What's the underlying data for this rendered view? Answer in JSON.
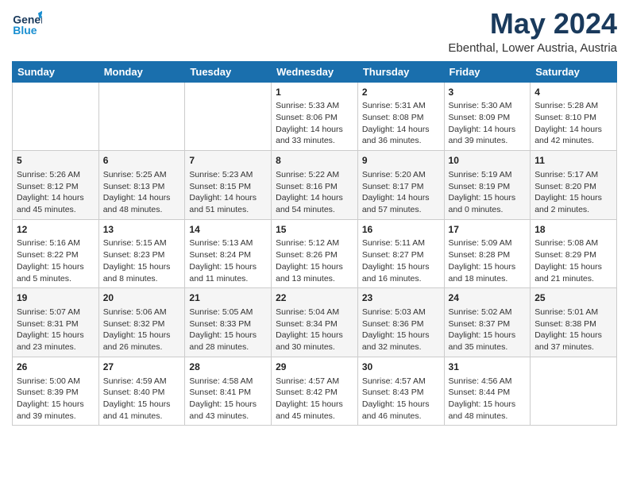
{
  "logo": {
    "line1": "General",
    "line2": "Blue"
  },
  "title": "May 2024",
  "location": "Ebenthal, Lower Austria, Austria",
  "days": [
    "Sunday",
    "Monday",
    "Tuesday",
    "Wednesday",
    "Thursday",
    "Friday",
    "Saturday"
  ],
  "weeks": [
    [
      {
        "day": "",
        "content": ""
      },
      {
        "day": "",
        "content": ""
      },
      {
        "day": "",
        "content": ""
      },
      {
        "day": "1",
        "content": "Sunrise: 5:33 AM\nSunset: 8:06 PM\nDaylight: 14 hours\nand 33 minutes."
      },
      {
        "day": "2",
        "content": "Sunrise: 5:31 AM\nSunset: 8:08 PM\nDaylight: 14 hours\nand 36 minutes."
      },
      {
        "day": "3",
        "content": "Sunrise: 5:30 AM\nSunset: 8:09 PM\nDaylight: 14 hours\nand 39 minutes."
      },
      {
        "day": "4",
        "content": "Sunrise: 5:28 AM\nSunset: 8:10 PM\nDaylight: 14 hours\nand 42 minutes."
      }
    ],
    [
      {
        "day": "5",
        "content": "Sunrise: 5:26 AM\nSunset: 8:12 PM\nDaylight: 14 hours\nand 45 minutes."
      },
      {
        "day": "6",
        "content": "Sunrise: 5:25 AM\nSunset: 8:13 PM\nDaylight: 14 hours\nand 48 minutes."
      },
      {
        "day": "7",
        "content": "Sunrise: 5:23 AM\nSunset: 8:15 PM\nDaylight: 14 hours\nand 51 minutes."
      },
      {
        "day": "8",
        "content": "Sunrise: 5:22 AM\nSunset: 8:16 PM\nDaylight: 14 hours\nand 54 minutes."
      },
      {
        "day": "9",
        "content": "Sunrise: 5:20 AM\nSunset: 8:17 PM\nDaylight: 14 hours\nand 57 minutes."
      },
      {
        "day": "10",
        "content": "Sunrise: 5:19 AM\nSunset: 8:19 PM\nDaylight: 15 hours\nand 0 minutes."
      },
      {
        "day": "11",
        "content": "Sunrise: 5:17 AM\nSunset: 8:20 PM\nDaylight: 15 hours\nand 2 minutes."
      }
    ],
    [
      {
        "day": "12",
        "content": "Sunrise: 5:16 AM\nSunset: 8:22 PM\nDaylight: 15 hours\nand 5 minutes."
      },
      {
        "day": "13",
        "content": "Sunrise: 5:15 AM\nSunset: 8:23 PM\nDaylight: 15 hours\nand 8 minutes."
      },
      {
        "day": "14",
        "content": "Sunrise: 5:13 AM\nSunset: 8:24 PM\nDaylight: 15 hours\nand 11 minutes."
      },
      {
        "day": "15",
        "content": "Sunrise: 5:12 AM\nSunset: 8:26 PM\nDaylight: 15 hours\nand 13 minutes."
      },
      {
        "day": "16",
        "content": "Sunrise: 5:11 AM\nSunset: 8:27 PM\nDaylight: 15 hours\nand 16 minutes."
      },
      {
        "day": "17",
        "content": "Sunrise: 5:09 AM\nSunset: 8:28 PM\nDaylight: 15 hours\nand 18 minutes."
      },
      {
        "day": "18",
        "content": "Sunrise: 5:08 AM\nSunset: 8:29 PM\nDaylight: 15 hours\nand 21 minutes."
      }
    ],
    [
      {
        "day": "19",
        "content": "Sunrise: 5:07 AM\nSunset: 8:31 PM\nDaylight: 15 hours\nand 23 minutes."
      },
      {
        "day": "20",
        "content": "Sunrise: 5:06 AM\nSunset: 8:32 PM\nDaylight: 15 hours\nand 26 minutes."
      },
      {
        "day": "21",
        "content": "Sunrise: 5:05 AM\nSunset: 8:33 PM\nDaylight: 15 hours\nand 28 minutes."
      },
      {
        "day": "22",
        "content": "Sunrise: 5:04 AM\nSunset: 8:34 PM\nDaylight: 15 hours\nand 30 minutes."
      },
      {
        "day": "23",
        "content": "Sunrise: 5:03 AM\nSunset: 8:36 PM\nDaylight: 15 hours\nand 32 minutes."
      },
      {
        "day": "24",
        "content": "Sunrise: 5:02 AM\nSunset: 8:37 PM\nDaylight: 15 hours\nand 35 minutes."
      },
      {
        "day": "25",
        "content": "Sunrise: 5:01 AM\nSunset: 8:38 PM\nDaylight: 15 hours\nand 37 minutes."
      }
    ],
    [
      {
        "day": "26",
        "content": "Sunrise: 5:00 AM\nSunset: 8:39 PM\nDaylight: 15 hours\nand 39 minutes."
      },
      {
        "day": "27",
        "content": "Sunrise: 4:59 AM\nSunset: 8:40 PM\nDaylight: 15 hours\nand 41 minutes."
      },
      {
        "day": "28",
        "content": "Sunrise: 4:58 AM\nSunset: 8:41 PM\nDaylight: 15 hours\nand 43 minutes."
      },
      {
        "day": "29",
        "content": "Sunrise: 4:57 AM\nSunset: 8:42 PM\nDaylight: 15 hours\nand 45 minutes."
      },
      {
        "day": "30",
        "content": "Sunrise: 4:57 AM\nSunset: 8:43 PM\nDaylight: 15 hours\nand 46 minutes."
      },
      {
        "day": "31",
        "content": "Sunrise: 4:56 AM\nSunset: 8:44 PM\nDaylight: 15 hours\nand 48 minutes."
      },
      {
        "day": "",
        "content": ""
      }
    ]
  ]
}
